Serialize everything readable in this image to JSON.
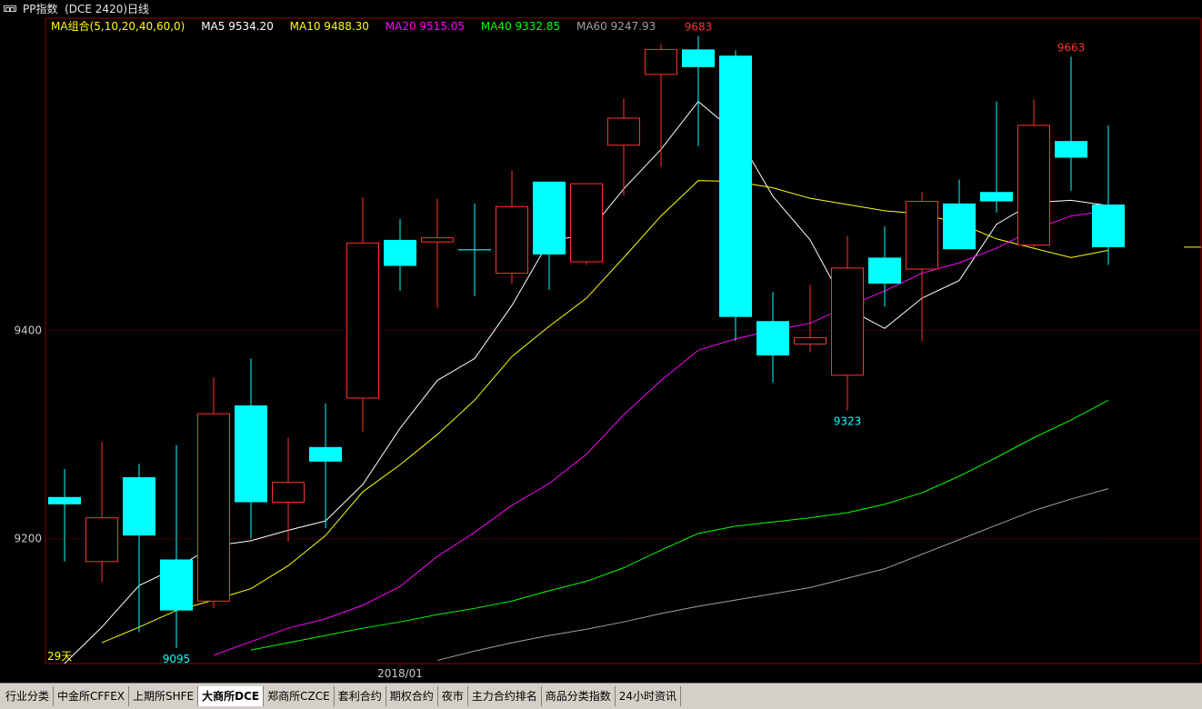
{
  "window": {
    "title": "PP指数  (DCE 2420)日线"
  },
  "ma_legend": {
    "group": "MA组合(5,10,20,40,60,0)",
    "items": [
      {
        "label": "MA5 9534.20",
        "color": "#ffffff"
      },
      {
        "label": "MA10 9488.30",
        "color": "#ffff00"
      },
      {
        "label": "MA20 9515.05",
        "color": "#ff00ff"
      },
      {
        "label": "MA40 9332.85",
        "color": "#00ff00"
      },
      {
        "label": "MA60 9247.93",
        "color": "#a0a0a0"
      }
    ],
    "group_color": "#ffff00"
  },
  "chart_data": {
    "type": "candlestick",
    "ylim": [
      9080,
      9700
    ],
    "y_ticks": [
      9200,
      9400
    ],
    "x_label": "2018/01",
    "x_label_index": 9,
    "days_label": "29天",
    "colors": {
      "up": "#ff3232",
      "down": "#00ffff",
      "grid": "#8b0000"
    },
    "candles": [
      {
        "o": 9240,
        "h": 9267,
        "l": 9178,
        "c": 9233
      },
      {
        "o": 9178,
        "h": 9293,
        "l": 9158,
        "c": 9220
      },
      {
        "o": 9259,
        "h": 9272,
        "l": 9110,
        "c": 9203
      },
      {
        "o": 9180,
        "h": 9290,
        "l": 9095,
        "c": 9131
      },
      {
        "o": 9140,
        "h": 9355,
        "l": 9133,
        "c": 9320
      },
      {
        "o": 9328,
        "h": 9373,
        "l": 9200,
        "c": 9235
      },
      {
        "o": 9235,
        "h": 9297,
        "l": 9197,
        "c": 9254
      },
      {
        "o": 9288,
        "h": 9330,
        "l": 9210,
        "c": 9274
      },
      {
        "o": 9335,
        "h": 9528,
        "l": 9303,
        "c": 9484
      },
      {
        "o": 9487,
        "h": 9507,
        "l": 9438,
        "c": 9462
      },
      {
        "o": 9485,
        "h": 9527,
        "l": 9422,
        "c": 9489
      },
      {
        "o": 9478,
        "h": 9522,
        "l": 9433,
        "c": 9477
      },
      {
        "o": 9455,
        "h": 9554,
        "l": 9445,
        "c": 9519
      },
      {
        "o": 9543,
        "h": 9535,
        "l": 9439,
        "c": 9473
      },
      {
        "o": 9466,
        "h": 9530,
        "l": 9463,
        "c": 9541
      },
      {
        "o": 9578,
        "h": 9623,
        "l": 9530,
        "c": 9604
      },
      {
        "o": 9646,
        "h": 9675,
        "l": 9557,
        "c": 9670
      },
      {
        "o": 9670,
        "h": 9683,
        "l": 9577,
        "c": 9653
      },
      {
        "o": 9664,
        "h": 9669,
        "l": 9390,
        "c": 9413
      },
      {
        "o": 9409,
        "h": 9437,
        "l": 9350,
        "c": 9376
      },
      {
        "o": 9387,
        "h": 9444,
        "l": 9379,
        "c": 9393
      },
      {
        "o": 9357,
        "h": 9491,
        "l": 9323,
        "c": 9460
      },
      {
        "o": 9470,
        "h": 9500,
        "l": 9423,
        "c": 9445
      },
      {
        "o": 9459,
        "h": 9533,
        "l": 9390,
        "c": 9524
      },
      {
        "o": 9522,
        "h": 9545,
        "l": 9478,
        "c": 9478
      },
      {
        "o": 9533,
        "h": 9620,
        "l": 9513,
        "c": 9524
      },
      {
        "o": 9482,
        "h": 9622,
        "l": 9479,
        "c": 9597
      },
      {
        "o": 9582,
        "h": 9663,
        "l": 9534,
        "c": 9566
      },
      {
        "o": 9521,
        "h": 9597,
        "l": 9463,
        "c": 9480
      }
    ],
    "series": [
      {
        "name": "MA5",
        "color": "#ffffff",
        "values": [
          9080,
          9115,
          9155,
          9172,
          9193,
          9198,
          9208,
          9217,
          9252,
          9306,
          9352,
          9373,
          9424,
          9486,
          9492,
          9536,
          9574,
          9620,
          9590,
          9529,
          9487,
          9421,
          9402,
          9431,
          9448,
          9502,
          9523,
          9525,
          9520
        ]
      },
      {
        "name": "MA10",
        "color": "#ffff00",
        "values": [
          null,
          9100,
          9115,
          9131,
          9141,
          9152,
          9174,
          9203,
          9245,
          9271,
          9300,
          9333,
          9375,
          9404,
          9431,
          9470,
          9510,
          9544,
          9543,
          9537,
          9527,
          9521,
          9515,
          9512,
          9503,
          9488,
          9479,
          9470,
          9477
        ]
      },
      {
        "name": "MA20",
        "color": "#ff00ff",
        "values": [
          null,
          null,
          null,
          null,
          9088,
          9101,
          9114,
          9123,
          9136,
          9154,
          9183,
          9206,
          9232,
          9253,
          9281,
          9319,
          9352,
          9381,
          9392,
          9400,
          9407,
          9423,
          9438,
          9455,
          9465,
          9479,
          9497,
          9510,
          9515
        ]
      },
      {
        "name": "MA40",
        "color": "#00ff00",
        "values": [
          null,
          null,
          null,
          null,
          null,
          9093,
          9100,
          9107,
          9114,
          9120,
          9127,
          9133,
          9140,
          9150,
          9159,
          9172,
          9189,
          9205,
          9212,
          9216,
          9220,
          9225,
          9233,
          9244,
          9260,
          9278,
          9297,
          9314,
          9333
        ]
      },
      {
        "name": "MA60",
        "color": "#a0a0a0",
        "values": [
          null,
          null,
          null,
          null,
          null,
          null,
          null,
          null,
          null,
          null,
          9083,
          9092,
          9100,
          9107,
          9113,
          9120,
          9128,
          9135,
          9141,
          9147,
          9153,
          9162,
          9171,
          9185,
          9199,
          9213,
          9227,
          9238,
          9248
        ]
      }
    ],
    "annotations": [
      {
        "text": "9683",
        "index": 17,
        "value": 9683,
        "position": "above",
        "color": "#ff3232"
      },
      {
        "text": "9663",
        "index": 27,
        "value": 9663,
        "position": "above",
        "color": "#ff3232"
      },
      {
        "text": "9323",
        "index": 21,
        "value": 9323,
        "position": "below",
        "color": "#00ffff"
      },
      {
        "text": "9095",
        "index": 3,
        "value": 9095,
        "position": "below",
        "color": "#00ffff"
      }
    ],
    "ma10_tail_value": 9480
  },
  "tabs": [
    {
      "label": "行业分类",
      "active": false
    },
    {
      "label": "中金所CFFEX",
      "active": false
    },
    {
      "label": "上期所SHFE",
      "active": false
    },
    {
      "label": "大商所DCE",
      "active": true
    },
    {
      "label": "郑商所CZCE",
      "active": false
    },
    {
      "label": "套利合约",
      "active": false
    },
    {
      "label": "期权合约",
      "active": false
    },
    {
      "label": "夜市",
      "active": false
    },
    {
      "label": "主力合约排名",
      "active": false
    },
    {
      "label": "商品分类指数",
      "active": false
    },
    {
      "label": "24小时资讯",
      "active": false
    }
  ]
}
